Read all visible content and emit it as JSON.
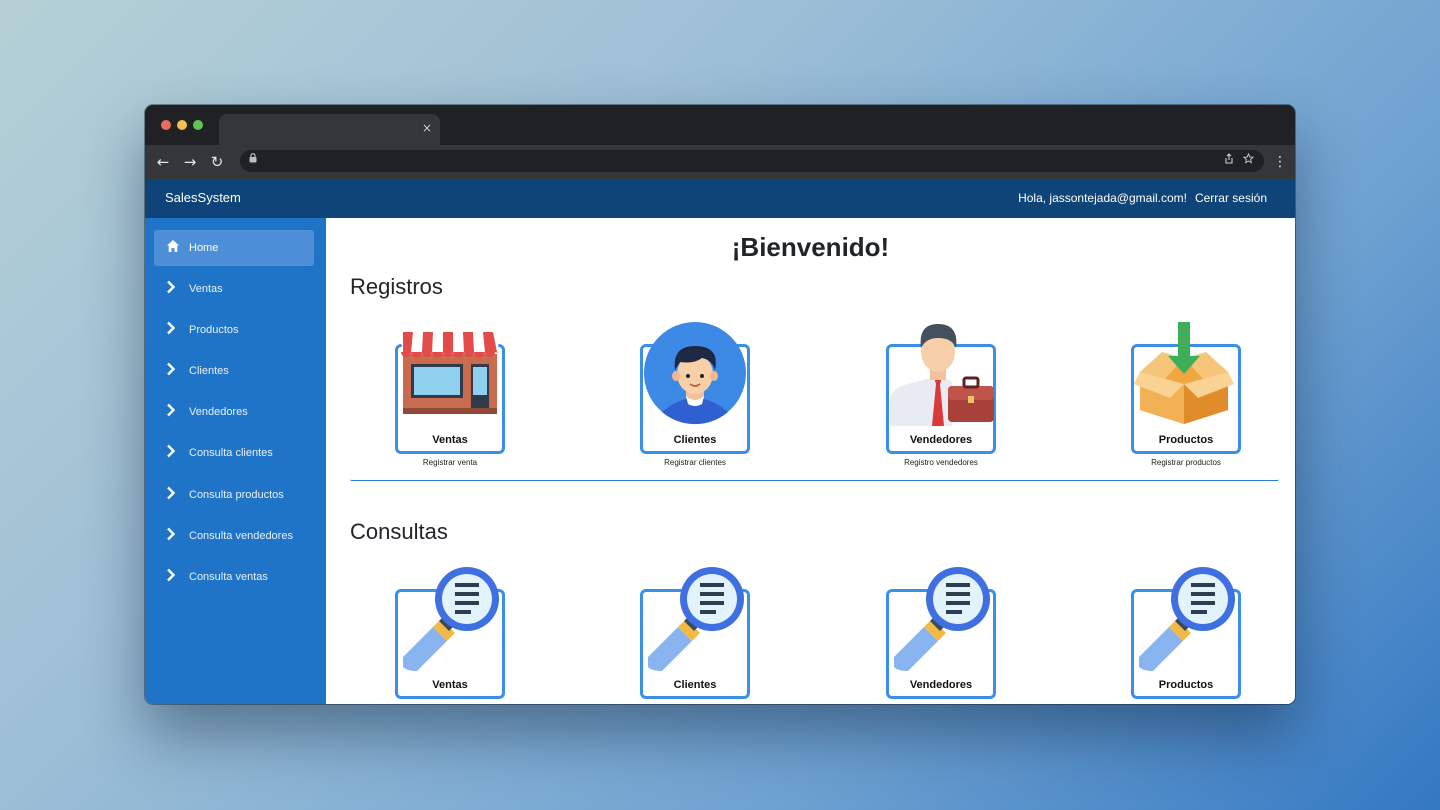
{
  "browser": {
    "tab_close": "×",
    "back": "←",
    "forward": "→",
    "reload": "↻",
    "menu": "⋮"
  },
  "app": {
    "brand": "SalesSystem",
    "greeting": "Hola, jassontejada@gmail.com!",
    "logout": "Cerrar sesión"
  },
  "sidebar": {
    "items": [
      {
        "label": "Home",
        "icon": "home-icon",
        "active": true
      },
      {
        "label": "Ventas",
        "icon": "chevron-right-icon"
      },
      {
        "label": "Productos",
        "icon": "chevron-right-icon"
      },
      {
        "label": "Clientes",
        "icon": "chevron-right-icon"
      },
      {
        "label": "Vendedores",
        "icon": "chevron-right-icon"
      },
      {
        "label": "Consulta clientes",
        "icon": "chevron-right-icon"
      },
      {
        "label": "Consulta productos",
        "icon": "chevron-right-icon"
      },
      {
        "label": "Consulta vendedores",
        "icon": "chevron-right-icon"
      },
      {
        "label": "Consulta ventas",
        "icon": "chevron-right-icon"
      }
    ]
  },
  "main": {
    "welcome": "¡Bienvenido!",
    "registros": {
      "title": "Registros",
      "cards": [
        {
          "label": "Ventas",
          "sub": "Registrar venta",
          "icon": "store-icon"
        },
        {
          "label": "Clientes",
          "sub": "Registrar clientes",
          "icon": "client-avatar-icon"
        },
        {
          "label": "Vendedores",
          "sub": "Registro vendedores",
          "icon": "salesman-icon"
        },
        {
          "label": "Productos",
          "sub": "Registrar productos",
          "icon": "box-icon"
        }
      ]
    },
    "consultas": {
      "title": "Consultas",
      "cards": [
        {
          "label": "Ventas",
          "icon": "magnifier-icon"
        },
        {
          "label": "Clientes",
          "icon": "magnifier-icon"
        },
        {
          "label": "Vendedores",
          "icon": "magnifier-icon"
        },
        {
          "label": "Productos",
          "icon": "magnifier-icon"
        }
      ]
    }
  },
  "colors": {
    "topbar": "#0f4478",
    "sidebar": "#1f74c7",
    "sidebar_active": "#4d8fd6",
    "card_border": "#3a8fe6"
  }
}
